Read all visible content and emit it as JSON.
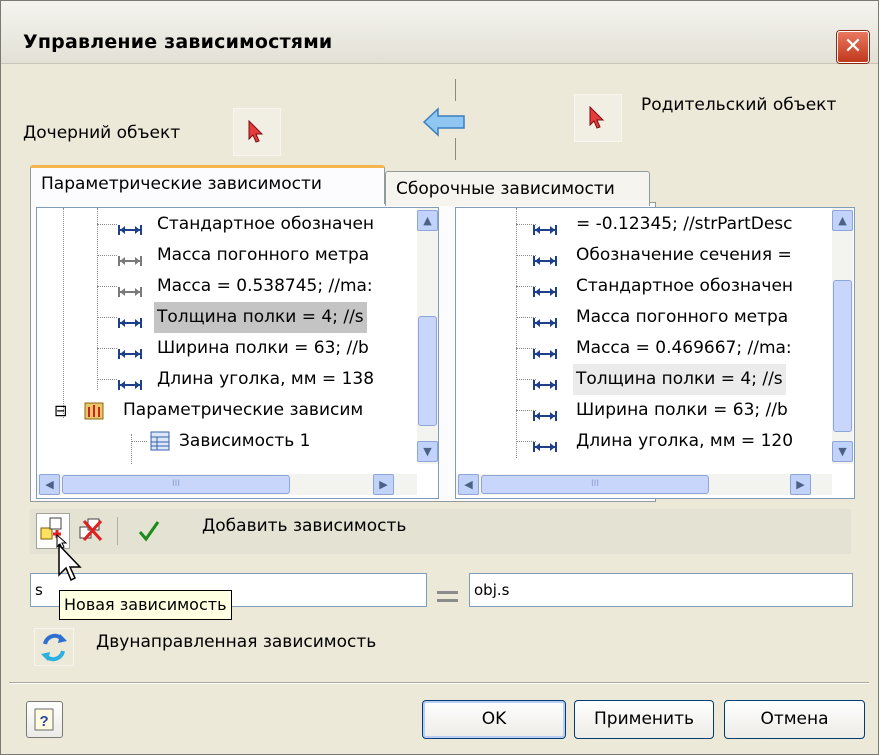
{
  "window": {
    "title": "Управление зависимостями"
  },
  "header": {
    "child_label": "Дочерний объект",
    "parent_label": "Родительский объект"
  },
  "tabs": [
    {
      "label": "Параметрические зависимости",
      "active": true
    },
    {
      "label": "Сборочные зависимости",
      "active": false
    }
  ],
  "left_tree": {
    "items": [
      {
        "label": "Стандартное обозначен",
        "icon": "dimension-icon"
      },
      {
        "label": "Масса погонного метра",
        "icon": "dimension-icon-gray"
      },
      {
        "label": "Масса = 0.538745; //ma:",
        "icon": "dimension-icon-gray"
      },
      {
        "label": "Толщина полки = 4; //s",
        "icon": "dimension-icon",
        "selected": true
      },
      {
        "label": "Ширина полки = 63; //b",
        "icon": "dimension-icon"
      },
      {
        "label": "Длина уголка, мм = 138",
        "icon": "dimension-icon"
      },
      {
        "label": "Параметрические зависим",
        "icon": "constraints-folder-icon",
        "expander": "⊟"
      },
      {
        "label": "Зависимость 1",
        "icon": "constraint-table-icon"
      }
    ]
  },
  "right_tree": {
    "items": [
      {
        "label": " = -0.12345; //strPartDesc",
        "icon": "dimension-icon"
      },
      {
        "label": "Обозначение сечения =",
        "icon": "dimension-icon"
      },
      {
        "label": "Стандартное обозначен",
        "icon": "dimension-icon"
      },
      {
        "label": "Масса погонного метра",
        "icon": "dimension-icon"
      },
      {
        "label": "Масса = 0.469667; //ma:",
        "icon": "dimension-icon"
      },
      {
        "label": "Толщина полки = 4; //s",
        "icon": "dimension-icon",
        "highlighted": true
      },
      {
        "label": "Ширина полки = 63; //b",
        "icon": "dimension-icon"
      },
      {
        "label": "Длина уголка, мм = 120",
        "icon": "dimension-icon"
      }
    ]
  },
  "scroll": {
    "up": "▲",
    "down": "▼",
    "left": "◀",
    "right": "▶",
    "grip": "III"
  },
  "toolbar": {
    "status_text": "Добавить зависимость",
    "buttons": [
      "new-constraint-icon",
      "delete-constraint-icon",
      "apply-check-icon"
    ]
  },
  "expression": {
    "left_value": "s",
    "right_value": "obj.s",
    "tooltip": "Новая зависимость"
  },
  "bidirectional": {
    "label": "Двунаправленная зависимость"
  },
  "buttons": {
    "ok": "OK",
    "apply": "Применить",
    "cancel": "Отмена"
  },
  "colors": {
    "accent": "#003c74",
    "tab_highlight": "#f5b44c",
    "close": "#c0391c"
  }
}
